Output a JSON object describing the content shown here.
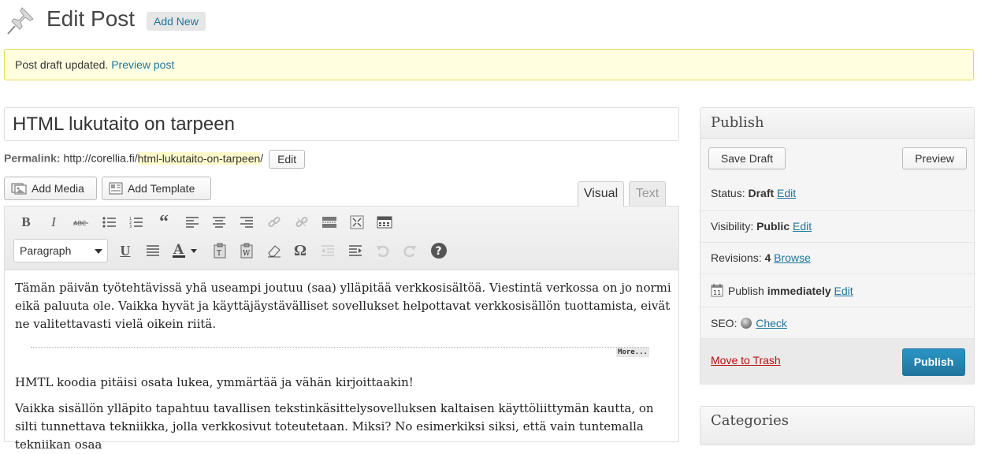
{
  "header": {
    "title": "Edit Post",
    "add_new": "Add New"
  },
  "notice": {
    "text": "Post draft updated.",
    "link": "Preview post"
  },
  "post": {
    "title": "HTML lukutaito on tarpeen",
    "permalink_label": "Permalink:",
    "permalink_base": "http://corellia.fi/",
    "permalink_slug": "html-lukutaito-on-tarpeen",
    "permalink_trailing": "/",
    "permalink_edit": "Edit"
  },
  "media": {
    "add_media": "Add Media",
    "add_template": "Add Template"
  },
  "tabs": {
    "visual": "Visual",
    "text": "Text"
  },
  "toolbar": {
    "format_value": "Paragraph"
  },
  "content": {
    "p1": "Tämän päivän työtehtävissä yhä useampi joutuu (saa) ylläpitää verkkosisältöä. Viestintä verkossa on jo normi eikä paluuta ole. Vaikka hyvät ja käyttäjäystävälliset sovellukset helpottavat verkkosisällön tuottamista, eivät ne valitettavasti vielä oikein riitä.",
    "more": "More...",
    "p2": "HMTL koodia pitäisi osata lukea, ymmärtää ja vähän kirjoittaakin!",
    "p3": "Vaikka sisällön ylläpito tapahtuu tavallisen tekstinkäsittelysovelluksen kaltaisen käyttöliittymän kautta, on silti tunnettava tekniikka, jolla verkkosivut toteutetaan. Miksi? No esimerkiksi siksi, että vain tuntemalla tekniikan osaa"
  },
  "publish": {
    "title": "Publish",
    "save_draft": "Save Draft",
    "preview": "Preview",
    "status_label": "Status:",
    "status_value": "Draft",
    "visibility_label": "Visibility:",
    "visibility_value": "Public",
    "revisions_label": "Revisions:",
    "revisions_value": "4",
    "revisions_link": "Browse",
    "publish_label": "Publish",
    "publish_value": "immediately",
    "seo_label": "SEO:",
    "seo_link": "Check",
    "edit": "Edit",
    "trash": "Move to Trash",
    "publish_button": "Publish",
    "calendar_day": "11"
  },
  "categories": {
    "title": "Categories"
  },
  "colors": {
    "link": "#21759b",
    "notice_bg": "#ffffe0",
    "primary": "#21759b",
    "trash": "#bc0b0b"
  }
}
